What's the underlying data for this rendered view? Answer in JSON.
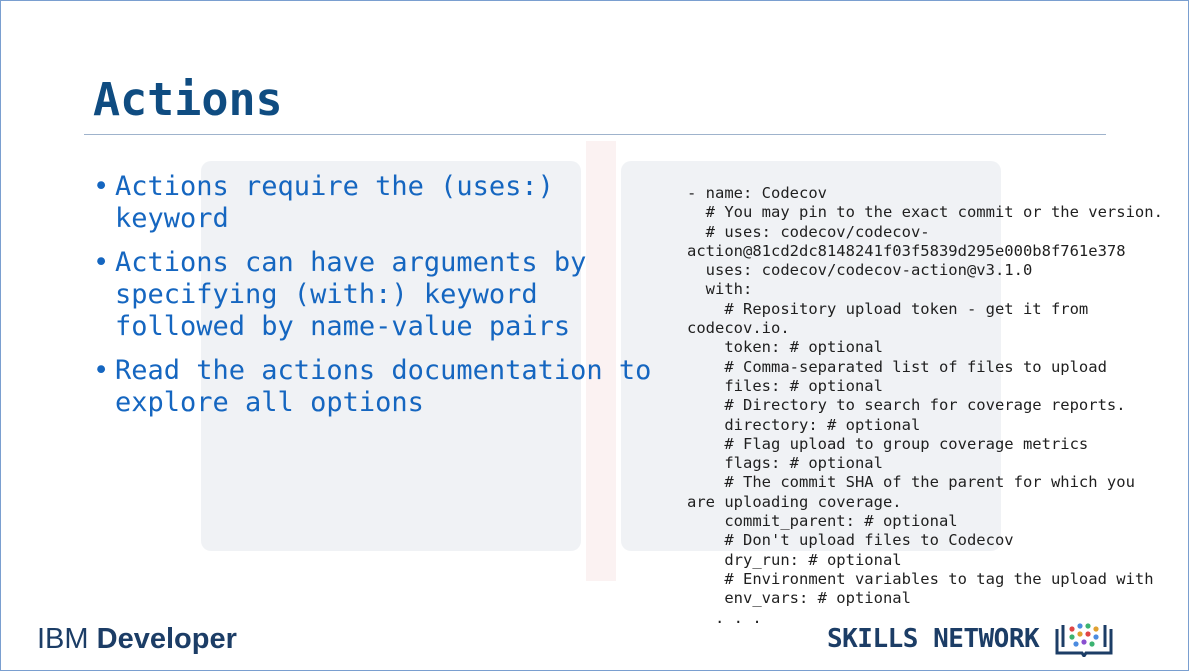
{
  "slide": {
    "title": "Actions",
    "bullets": [
      "Actions require the (uses:) keyword",
      "Actions can have arguments by specifying (with:) keyword followed by name-value pairs",
      "Read the actions documentation to explore all options"
    ],
    "bullet_symbol": "•",
    "code_lines": [
      "- name: Codecov",
      "  # You may pin to the exact commit or the version.",
      "  # uses: codecov/codecov-",
      "action@81cd2dc8148241f03f5839d295e000b8f761e378",
      "  uses: codecov/codecov-action@v3.1.0",
      "  with:",
      "    # Repository upload token - get it from",
      "codecov.io.",
      "    token: # optional",
      "    # Comma-separated list of files to upload",
      "    files: # optional",
      "    # Directory to search for coverage reports.",
      "    directory: # optional",
      "    # Flag upload to group coverage metrics",
      "    flags: # optional",
      "    # The commit SHA of the parent for which you",
      "are uploading coverage.",
      "    commit_parent: # optional",
      "    # Don't upload files to Codecov",
      "    dry_run: # optional",
      "    # Environment variables to tag the upload with",
      "    env_vars: # optional",
      "   . . ."
    ]
  },
  "footer": {
    "ibm_brand": "IBM",
    "ibm_product": "Developer",
    "skills_network": "SKILLS NETWORK",
    "skills_icon": "open-book-network-icon"
  },
  "colors": {
    "title": "#0f4c81",
    "bullets": "#1566c0",
    "code": "#1f1f1f",
    "logo": "#1c3d66",
    "rule": "#9fb3cc"
  }
}
